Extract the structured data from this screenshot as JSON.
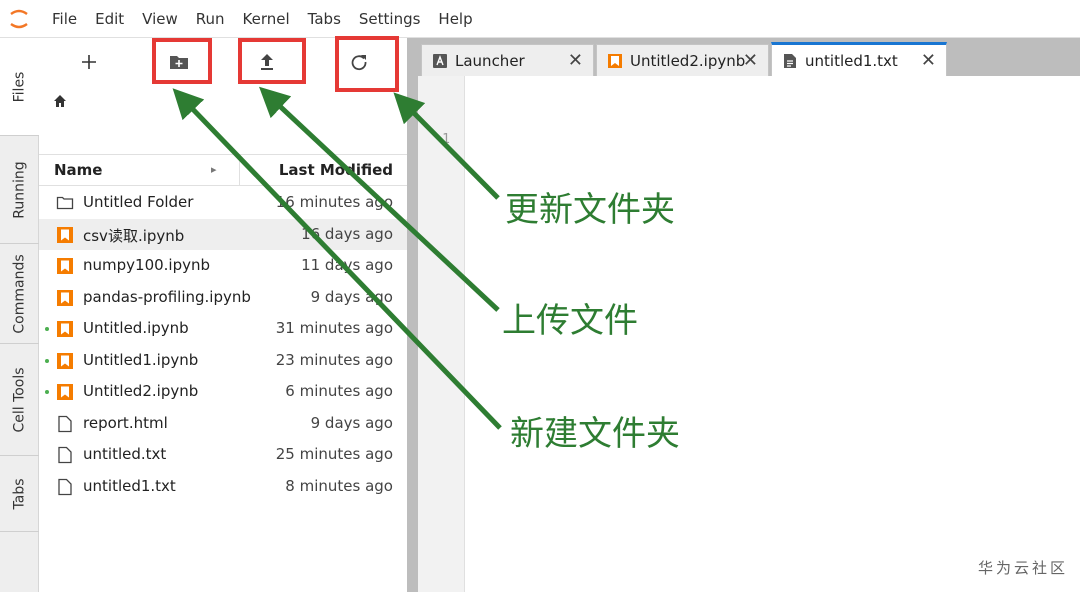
{
  "menubar": {
    "items": [
      "File",
      "Edit",
      "View",
      "Run",
      "Kernel",
      "Tabs",
      "Settings",
      "Help"
    ]
  },
  "left_sidebar": {
    "tabs": [
      "Files",
      "Running",
      "Commands",
      "Cell Tools",
      "Tabs"
    ]
  },
  "file_browser": {
    "toolbar": {
      "new_launcher_icon": "plus-icon",
      "new_folder_icon": "new-folder-icon",
      "upload_icon": "upload-icon",
      "refresh_icon": "refresh-icon"
    },
    "breadcrumb_icon": "home-icon",
    "columns": {
      "name": "Name",
      "modified": "Last Modified"
    },
    "files": [
      {
        "name": "Untitled Folder",
        "modified": "16 minutes ago",
        "type": "folder",
        "running": false,
        "selected": false
      },
      {
        "name": "csv读取.ipynb",
        "modified": "16 days ago",
        "type": "notebook",
        "running": false,
        "selected": true
      },
      {
        "name": "numpy100.ipynb",
        "modified": "11 days ago",
        "type": "notebook",
        "running": false,
        "selected": false
      },
      {
        "name": "pandas-profiling.ipynb",
        "modified": "9 days ago",
        "type": "notebook",
        "running": false,
        "selected": false
      },
      {
        "name": "Untitled.ipynb",
        "modified": "31 minutes ago",
        "type": "notebook",
        "running": true,
        "selected": false
      },
      {
        "name": "Untitled1.ipynb",
        "modified": "23 minutes ago",
        "type": "notebook",
        "running": true,
        "selected": false
      },
      {
        "name": "Untitled2.ipynb",
        "modified": "6 minutes ago",
        "type": "notebook",
        "running": true,
        "selected": false
      },
      {
        "name": "report.html",
        "modified": "9 days ago",
        "type": "file",
        "running": false,
        "selected": false
      },
      {
        "name": "untitled.txt",
        "modified": "25 minutes ago",
        "type": "file",
        "running": false,
        "selected": false
      },
      {
        "name": "untitled1.txt",
        "modified": "8 minutes ago",
        "type": "file",
        "running": false,
        "selected": false
      }
    ]
  },
  "tabs": [
    {
      "label": "Launcher",
      "icon": "launcher-icon",
      "close": "✕"
    },
    {
      "label": "Untitled2.ipynb",
      "icon": "notebook-icon",
      "close": "✕"
    },
    {
      "label": "untitled1.txt",
      "icon": "text-file-icon",
      "close": "✕"
    }
  ],
  "editor": {
    "line_number": "1"
  },
  "annotations": {
    "refresh": "更新文件夹",
    "upload": "上传文件",
    "new_folder": "新建文件夹",
    "box_color": "#e53935",
    "arrow_color": "#2e7d32"
  },
  "watermark": "华为云社区",
  "colors": {
    "accent": "#1976d2",
    "notebook_orange": "#f57c00",
    "running_dot": "#4caf50"
  }
}
